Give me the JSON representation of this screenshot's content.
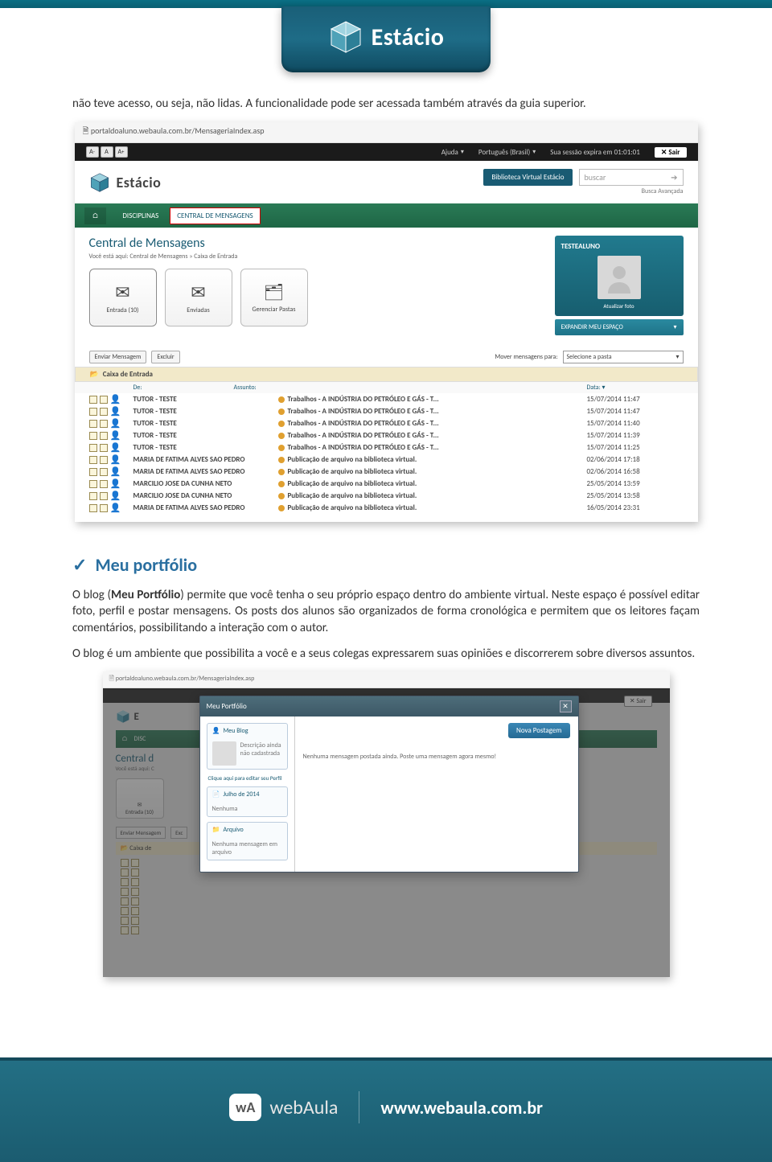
{
  "brand": {
    "name": "Estácio"
  },
  "intro": "não teve acesso, ou seja, não lidas. A funcionalidade pode ser acessada também através da guia superior.",
  "s1": {
    "url": "portaldoaluno.webaula.com.br/MensageriaIndex.asp",
    "ajuda": "Ajuda",
    "lang": "Português (Brasil)",
    "session": "Sua sessão expira em 01:01:01",
    "sair": "Sair",
    "bib": "Biblioteca Virtual Estácio",
    "search_ph": "buscar",
    "busca_av": "Busca Avançada",
    "nav_disc": "DISCIPLINAS",
    "nav_central": "CENTRAL DE MENSAGENS",
    "title": "Central de Mensagens",
    "breadcrumb": "Você está aqui: Central de Mensagens » Caixa de Entrada",
    "tiles": [
      {
        "label": "Entrada (10)"
      },
      {
        "label": "Enviadas"
      },
      {
        "label": "Gerenciar Pastas"
      }
    ],
    "user": {
      "name": "TESTEALUNO",
      "update": "Atualizar foto",
      "expand": "EXPANDIR MEU ESPAÇO"
    },
    "toolbar": {
      "enviar": "Enviar Mensagem",
      "excluir": "Excluir",
      "mover": "Mover mensagens para:",
      "select": "Selecione a pasta"
    },
    "inbox": "Caixa de Entrada",
    "cols": {
      "de": "De:",
      "assunto": "Assunto:",
      "data": "Data:"
    },
    "rows": [
      {
        "de": "TUTOR - TESTE",
        "as": "Trabalhos - A INDÚSTRIA DO PETRÓLEO E GÁS - T...",
        "dt": "15/07/2014 11:47"
      },
      {
        "de": "TUTOR - TESTE",
        "as": "Trabalhos - A INDÚSTRIA DO PETRÓLEO E GÁS - T...",
        "dt": "15/07/2014 11:47"
      },
      {
        "de": "TUTOR - TESTE",
        "as": "Trabalhos - A INDÚSTRIA DO PETRÓLEO E GÁS - T...",
        "dt": "15/07/2014 11:40"
      },
      {
        "de": "TUTOR - TESTE",
        "as": "Trabalhos - A INDÚSTRIA DO PETRÓLEO E GÁS - T...",
        "dt": "15/07/2014 11:39"
      },
      {
        "de": "TUTOR - TESTE",
        "as": "Trabalhos - A INDÚSTRIA DO PETRÓLEO E GÁS - T...",
        "dt": "15/07/2014 11:25"
      },
      {
        "de": "MARIA DE FATIMA ALVES SAO PEDRO",
        "as": "Publicação de arquivo na biblioteca virtual.",
        "dt": "02/06/2014 17:18"
      },
      {
        "de": "MARIA DE FATIMA ALVES SAO PEDRO",
        "as": "Publicação de arquivo na biblioteca virtual.",
        "dt": "02/06/2014 16:58"
      },
      {
        "de": "MARCILIO JOSE DA CUNHA NETO",
        "as": "Publicação de arquivo na biblioteca virtual.",
        "dt": "25/05/2014 13:59"
      },
      {
        "de": "MARCILIO JOSE DA CUNHA NETO",
        "as": "Publicação de arquivo na biblioteca virtual.",
        "dt": "25/05/2014 13:58"
      },
      {
        "de": "MARIA DE FATIMA ALVES SAO PEDRO",
        "as": "Publicação de arquivo na biblioteca virtual.",
        "dt": "16/05/2014 23:31"
      }
    ]
  },
  "section": {
    "heading": "Meu portfólio",
    "p1_a": "O blog (",
    "p1_b": "Meu Portfólio",
    "p1_c": ") permite que você tenha o seu próprio espaço dentro do ambiente virtual. Neste espaço é possível editar foto, perfil e postar mensagens. Os posts dos alunos são organizados de forma cronológica e permitem que os leitores façam comentários, possibilitando a interação com o autor.",
    "p2": "O blog é um ambiente que possibilita a você e a seus colegas expressarem suas opiniões e discorrerem sobre diversos assuntos."
  },
  "s2": {
    "url": "portaldoaluno.webaula.com.br/MensageriaIndex.asp",
    "sair": "Sair",
    "nav_disc": "DISC",
    "central": "Central d",
    "bc": "Você está aqui: C",
    "tile": "Entrada (10)",
    "btn1": "Enviar Mensagem",
    "btn2": "Exc",
    "inbox": "Caixa de",
    "modal": {
      "title": "Meu Portfólio",
      "blog": "Meu Blog",
      "desc": "Descrição ainda não cadastrada",
      "edit": "Clique aqui para editar seu Perfil",
      "month": "Julho de 2014",
      "month_body": "Nenhuma",
      "arquivo": "Arquivo",
      "arquivo_body": "Nenhuma mensagem em arquivo",
      "nova": "Nova Postagem",
      "empty": "Nenhuma mensagem postada ainda. Poste uma mensagem agora mesmo!"
    }
  },
  "footer": {
    "wa": "wA",
    "brand": "webAula",
    "url": "www.webaula.com.br"
  }
}
